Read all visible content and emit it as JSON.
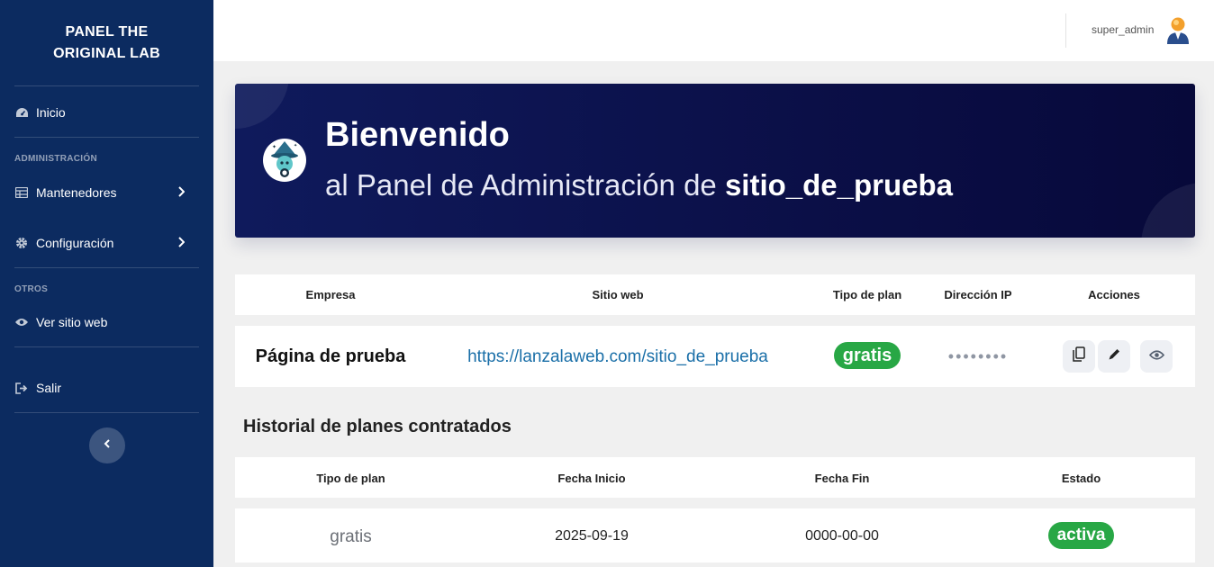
{
  "sidebar": {
    "brand_line1": "PANEL THE",
    "brand_line2": "ORIGINAL LAB",
    "items": {
      "inicio": "Inicio",
      "mantenedores": "Mantenedores",
      "configuracion": "Configuración",
      "ver_sitio": "Ver sitio web",
      "salir": "Salir"
    },
    "sections": {
      "admin": "ADMINISTRACIÓN",
      "otros": "OTROS"
    },
    "icons": [
      "dashboard-icon",
      "table-icon",
      "gear-icon",
      "eye-icon",
      "logout-icon",
      "chevron-right-icon",
      "chevron-left-icon"
    ],
    "color": "#0c2b60"
  },
  "topbar": {
    "username": "super_admin"
  },
  "banner": {
    "title": "Bienvenido",
    "subtitle_prefix": "al Panel de Administración de",
    "site_name": "sitio_de_prueba"
  },
  "site_table": {
    "headers": {
      "empresa": "Empresa",
      "sitio": "Sitio web",
      "plan": "Tipo de plan",
      "ip": "Dirección IP",
      "acciones": "Acciones"
    },
    "row": {
      "empresa": "Página de prueba",
      "sitio": "https://lanzalaweb.com/sitio_de_prueba",
      "plan": "gratis",
      "ip": "••••••••"
    },
    "action_icons": [
      "copy-icon",
      "pencil-icon",
      "eye-icon"
    ]
  },
  "history": {
    "title": "Historial de planes contratados",
    "headers": {
      "plan": "Tipo de plan",
      "inicio": "Fecha Inicio",
      "fin": "Fecha Fin",
      "estado": "Estado"
    },
    "row": {
      "plan": "gratis",
      "inicio": "2025-09-19",
      "fin": "0000-00-00",
      "estado": "activa"
    }
  },
  "colors": {
    "badge_green": "#28a745",
    "link_blue": "#1a6fa8"
  }
}
